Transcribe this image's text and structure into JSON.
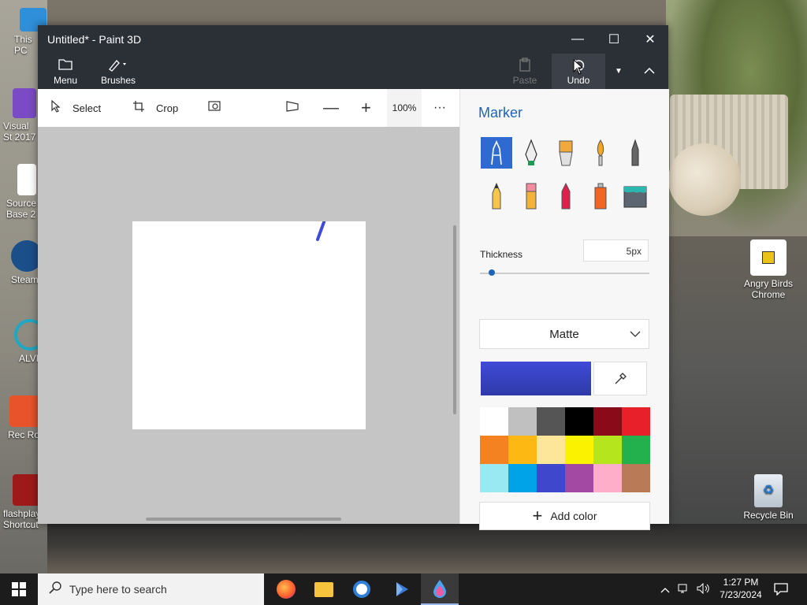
{
  "window": {
    "title": "Untitled* - Paint 3D",
    "minimize": "—",
    "maximize": "☐",
    "close": "✕"
  },
  "ribbon": {
    "menu": "Menu",
    "brushes": "Brushes",
    "paste": "Paste",
    "undo": "Undo"
  },
  "toolbar": {
    "select": "Select",
    "crop": "Crop",
    "zoom": "100%",
    "more": "···"
  },
  "panel": {
    "title": "Marker",
    "thickness_label": "Thickness",
    "thickness_value": "5px",
    "thickness_fraction": 0.05,
    "finish": "Matte",
    "add_color": "Add color",
    "current_color": "#3f4ad8",
    "swatches": [
      "#ffffff",
      "#c0c0c0",
      "#555555",
      "#000000",
      "#8b0a1a",
      "#e8202a",
      "#f58220",
      "#fdb813",
      "#fde699",
      "#fbf200",
      "#b5e61d",
      "#22b14c",
      "#99e9f2",
      "#00a2e8",
      "#3f48cc",
      "#a349a4",
      "#ffaec9",
      "#b97a57"
    ]
  },
  "desktop": {
    "icons": [
      {
        "label": "This PC"
      },
      {
        "label": "Visual St 2017"
      },
      {
        "label": "Source Base 2"
      },
      {
        "label": "Steam"
      },
      {
        "label": "ALVR"
      },
      {
        "label": "Rec Ro"
      },
      {
        "label": "flashplay - Shortcut"
      },
      {
        "label": "Angry Birds Chrome"
      },
      {
        "label": "Recycle Bin"
      }
    ]
  },
  "taskbar": {
    "search_placeholder": "Type here to search",
    "time": "1:27 PM",
    "date": "7/23/2024"
  }
}
